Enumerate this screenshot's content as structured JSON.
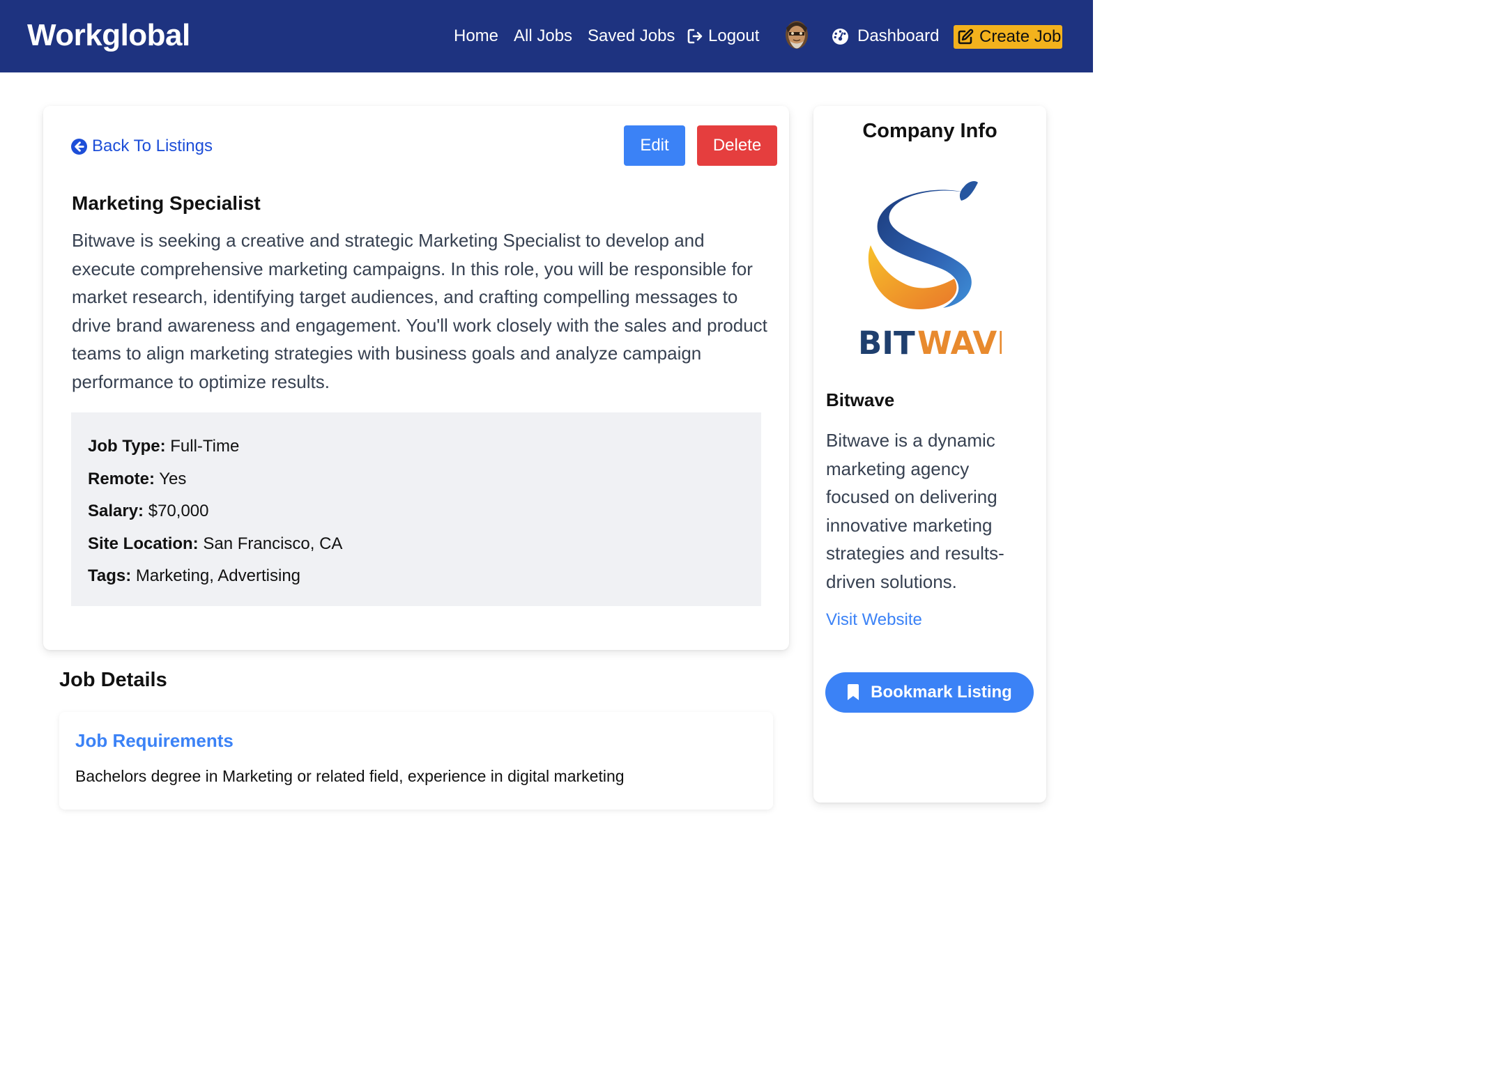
{
  "header": {
    "brand": "Workglobal",
    "nav": {
      "home": "Home",
      "all_jobs": "All Jobs",
      "saved_jobs": "Saved Jobs",
      "logout": "Logout",
      "dashboard": "Dashboard",
      "create_job": "Create Job"
    },
    "colors": {
      "background": "#1e3380",
      "create_button": "#f3b21d"
    }
  },
  "job": {
    "back_label": "Back To Listings",
    "edit_label": "Edit",
    "delete_label": "Delete",
    "title": "Marketing Specialist",
    "description": "Bitwave is seeking a creative and strategic Marketing Specialist to develop and execute comprehensive marketing campaigns. In this role, you will be responsible for market research, identifying target audiences, and crafting compelling messages to drive brand awareness and engagement. You'll work closely with the sales and product teams to align marketing strategies with business goals and analyze campaign performance to optimize results.",
    "meta": {
      "job_type_label": "Job Type:",
      "job_type": "Full-Time",
      "remote_label": "Remote:",
      "remote": "Yes",
      "salary_label": "Salary:",
      "salary": "$70,000",
      "location_label": "Site Location:",
      "location": "San Francisco, CA",
      "tags_label": "Tags:",
      "tags": "Marketing, Advertising"
    },
    "colors": {
      "edit": "#3b82f6",
      "delete": "#e53e3e"
    }
  },
  "details": {
    "heading": "Job Details",
    "requirements_title": "Job Requirements",
    "requirements_text": "Bachelors degree in Marketing or related field, experience in digital marketing"
  },
  "company": {
    "section_title": "Company Info",
    "logo_text_1": "BIT",
    "logo_text_2": "WAVE",
    "name": "Bitwave",
    "description": "Bitwave is a dynamic marketing agency focused on delivering innovative marketing strategies and results-driven solutions.",
    "website_label": "Visit Website",
    "bookmark_label": "Bookmark Listing"
  },
  "icons": [
    "logout-icon",
    "avatar",
    "dashboard-icon",
    "edit-icon",
    "back-arrow-icon",
    "bookmark-icon"
  ]
}
